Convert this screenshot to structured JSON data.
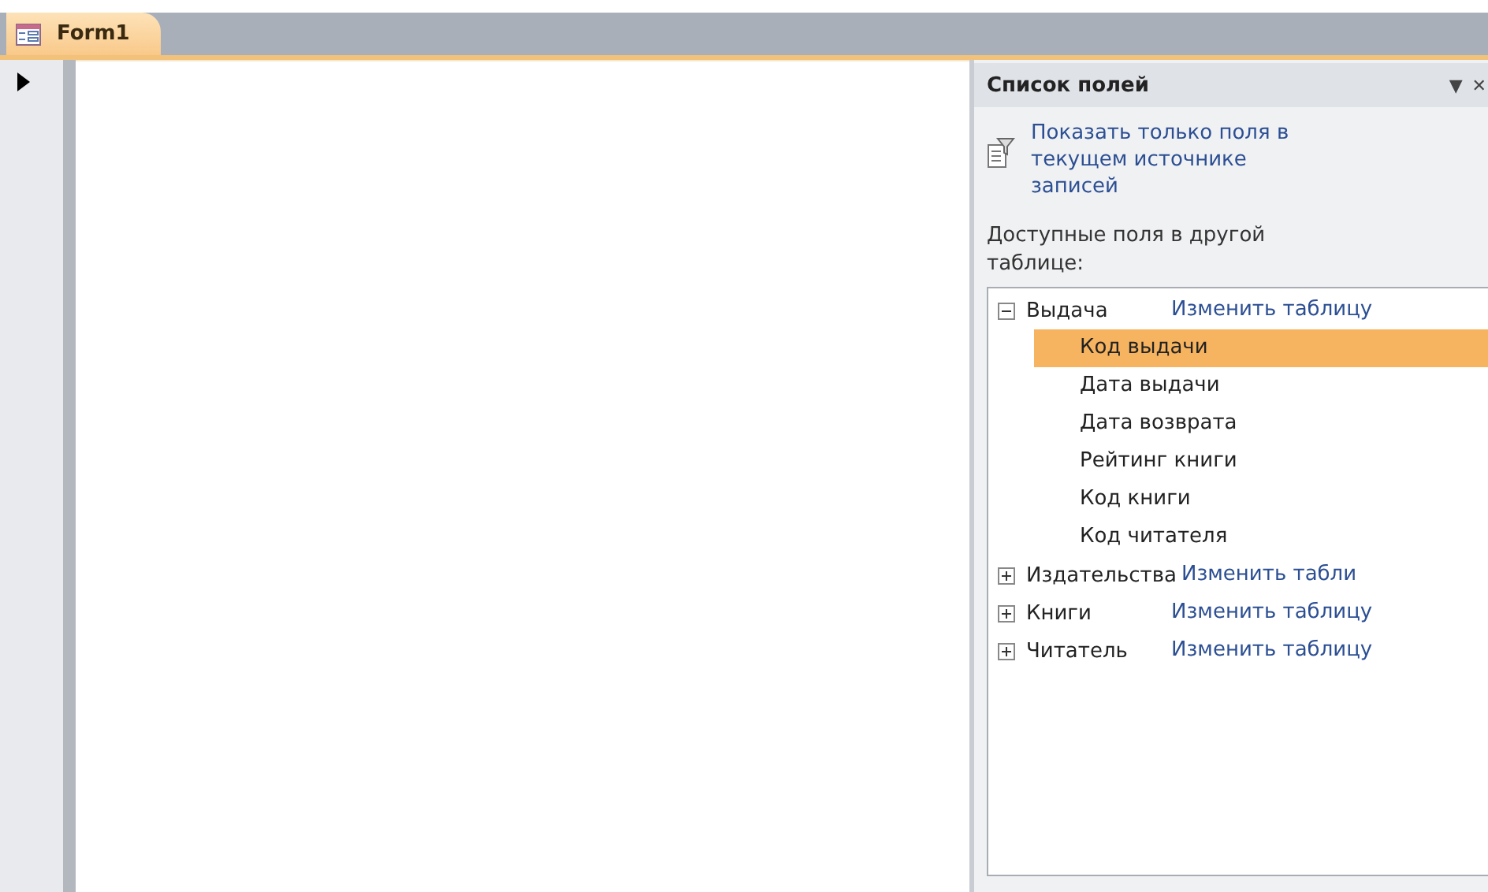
{
  "tabs": [
    {
      "label": "Form1",
      "selected": true
    }
  ],
  "field_list": {
    "title": "Список полей",
    "menu_glyph": "▼",
    "close_glyph": "✕",
    "show_only_link": "Показать только поля в текущем источнике записей",
    "available_label": "Доступные поля в другой таблице:",
    "tables": [
      {
        "name": "Выдача",
        "expanded": true,
        "edit_link": "Изменить таблицу",
        "fields": [
          {
            "name": "Код выдачи",
            "selected": true
          },
          {
            "name": "Дата выдачи",
            "selected": false
          },
          {
            "name": "Дата возврата",
            "selected": false
          },
          {
            "name": "Рейтинг книги",
            "selected": false
          },
          {
            "name": "Код книги",
            "selected": false
          },
          {
            "name": "Код читателя",
            "selected": false
          }
        ]
      },
      {
        "name": "Издательства",
        "expanded": false,
        "edit_link": "Изменить табли"
      },
      {
        "name": "Книги",
        "expanded": false,
        "edit_link": "Изменить таблицу"
      },
      {
        "name": "Читатель",
        "expanded": false,
        "edit_link": "Изменить таблицу"
      }
    ]
  }
}
